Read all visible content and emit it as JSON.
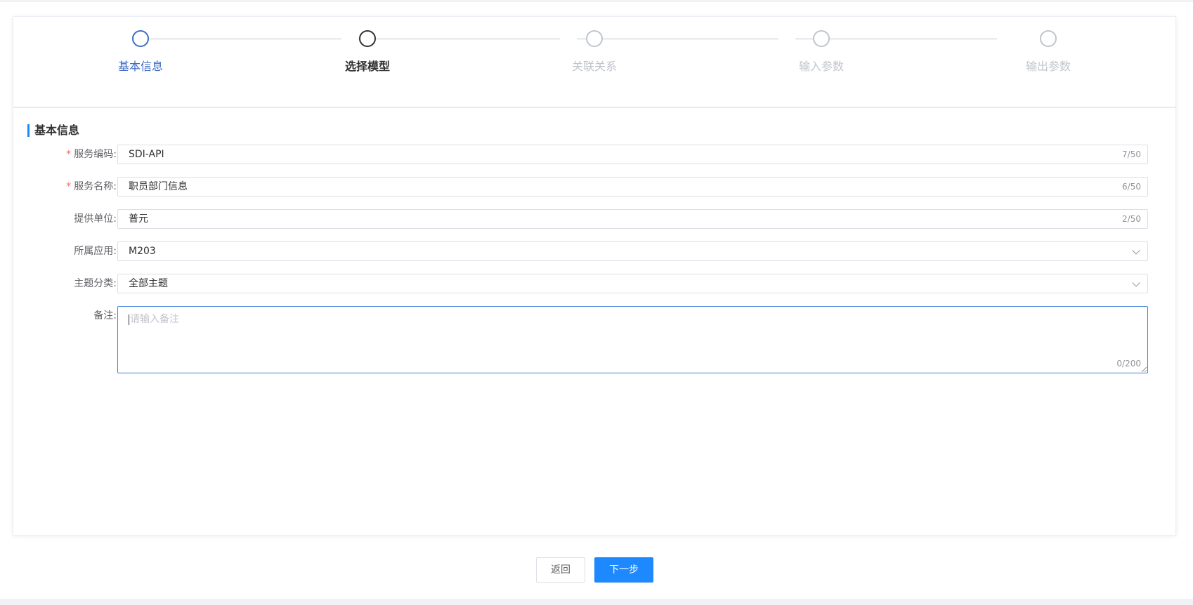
{
  "steps": [
    {
      "label": "基本信息",
      "state": "done"
    },
    {
      "label": "选择模型",
      "state": "active"
    },
    {
      "label": "关联关系",
      "state": "pending"
    },
    {
      "label": "输入参数",
      "state": "pending"
    },
    {
      "label": "输出参数",
      "state": "pending"
    }
  ],
  "section": {
    "title": "基本信息"
  },
  "form": {
    "required_mark": "*",
    "service_code": {
      "label": "服务编码:",
      "value": "SDI-API",
      "counter": "7/50"
    },
    "service_name": {
      "label": "服务名称:",
      "value": "职员部门信息",
      "counter": "6/50"
    },
    "provider": {
      "label": "提供单位:",
      "value": "普元",
      "counter": "2/50"
    },
    "application": {
      "label": "所属应用:",
      "value": "M203"
    },
    "topic": {
      "label": "主题分类:",
      "value": "全部主题"
    },
    "remark": {
      "label": "备注:",
      "placeholder": "请输入备注",
      "counter": "0/200"
    }
  },
  "buttons": {
    "back": "返回",
    "next": "下一步"
  },
  "colors": {
    "primary": "#1e88ff",
    "step_done": "#3d6bc7",
    "required": "#f56c6c"
  }
}
